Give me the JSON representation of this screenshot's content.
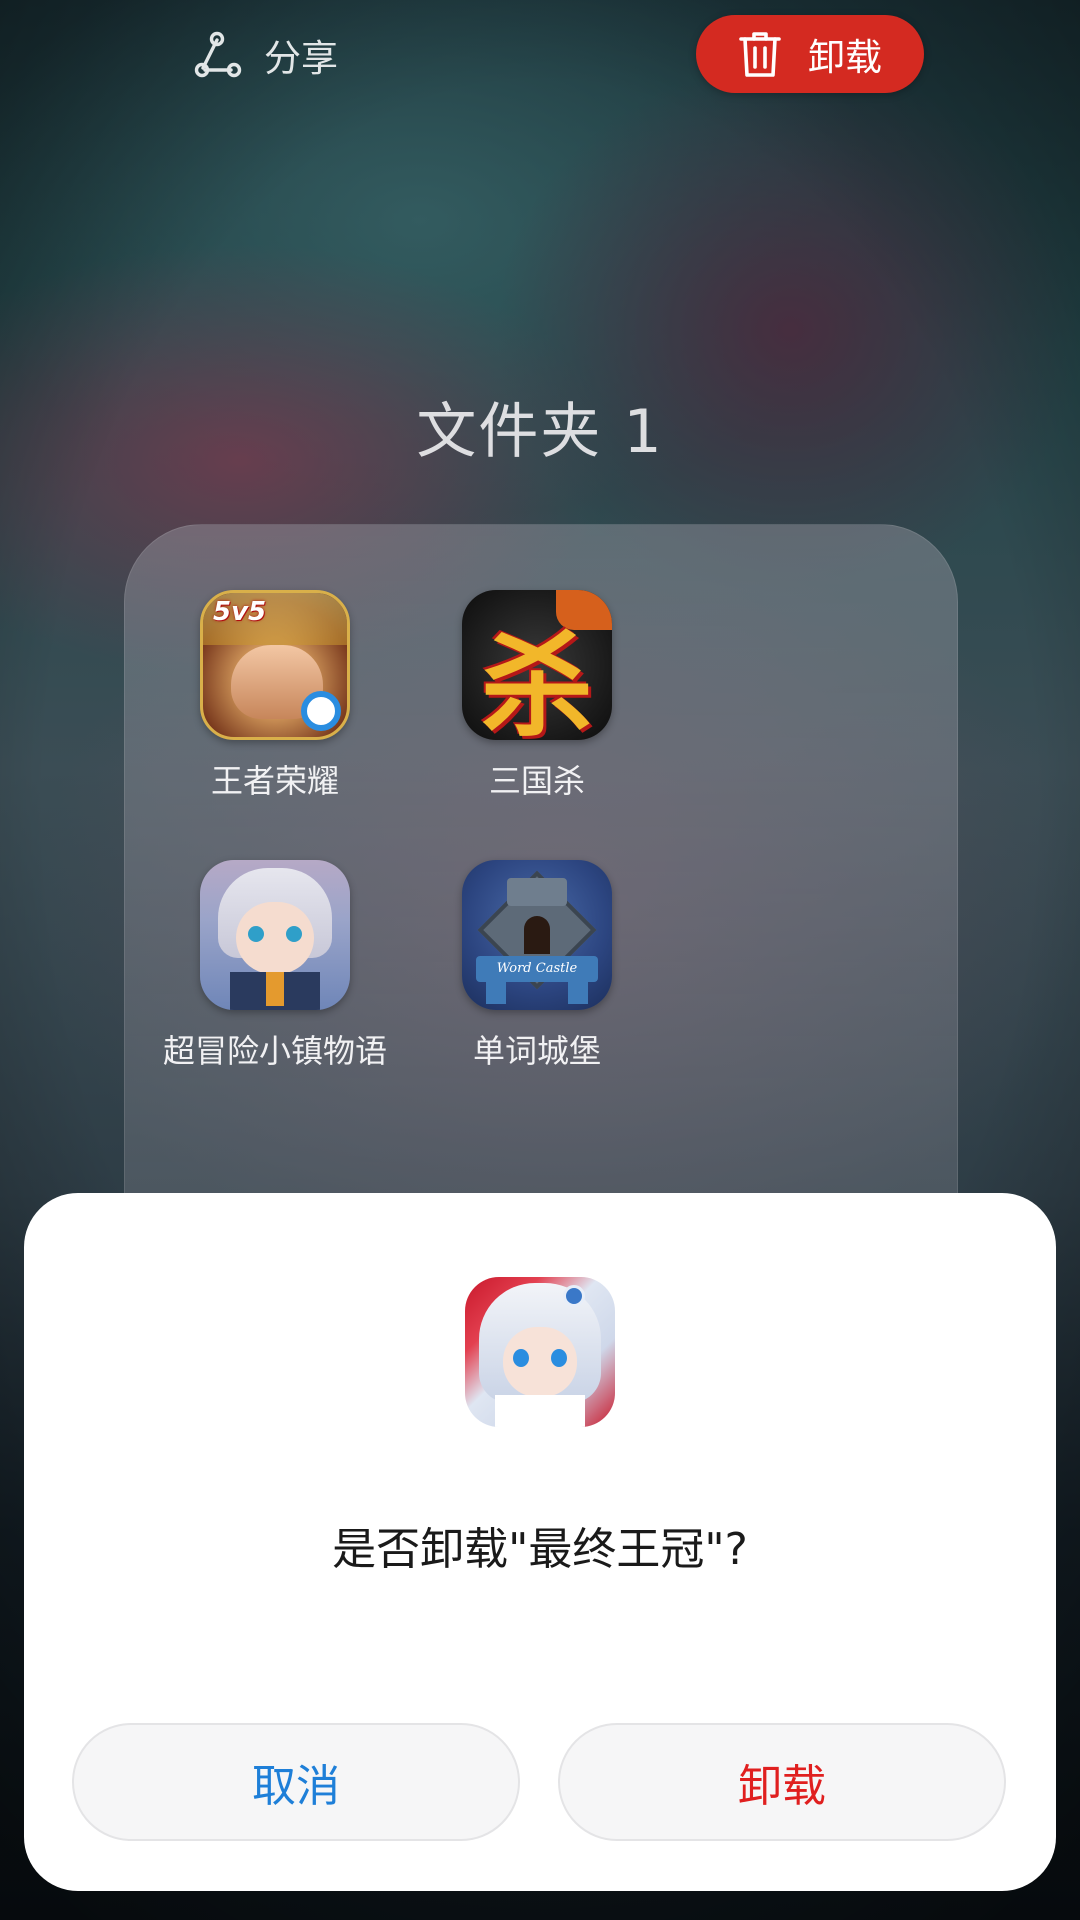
{
  "top_bar": {
    "share_label": "分享",
    "uninstall_label": "卸载",
    "uninstall_color": "#d42a21"
  },
  "folder": {
    "title": "文件夹 1",
    "apps": [
      {
        "label": "王者荣耀",
        "icon": "honor-of-kings-app-icon",
        "badge": "5v5"
      },
      {
        "label": "三国杀",
        "icon": "sanguosha-app-icon",
        "glyph": "杀"
      },
      {
        "label": "超冒险小镇物语",
        "icon": "adventure-town-app-icon"
      },
      {
        "label": "单词城堡",
        "icon": "word-castle-app-icon",
        "banner": "Word Castle"
      }
    ]
  },
  "dialog": {
    "app_icon": "final-crown-app-icon",
    "message": "是否卸载\"最终王冠\"?",
    "cancel_label": "取消",
    "confirm_label": "卸载",
    "cancel_color": "#1e7fd8",
    "confirm_color": "#e01f1f"
  }
}
